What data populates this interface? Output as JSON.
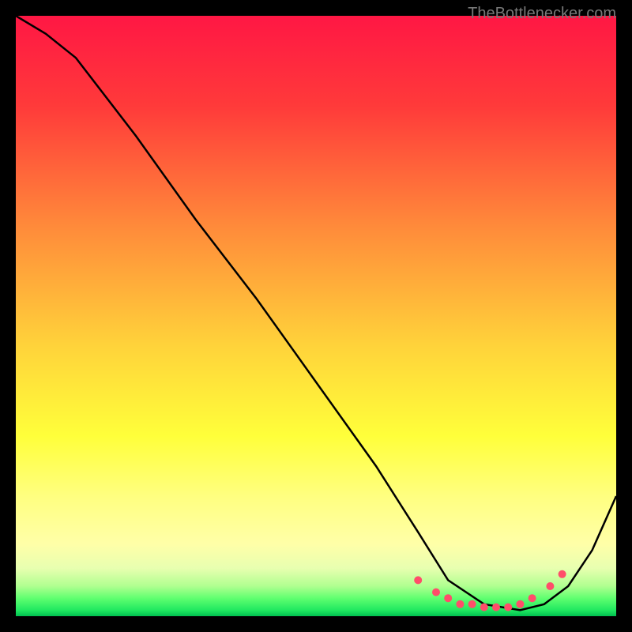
{
  "attribution": "TheBottlenecker.com",
  "chart_data": {
    "type": "line",
    "title": "",
    "xlabel": "",
    "ylabel": "",
    "xlim": [
      0,
      100
    ],
    "ylim": [
      0,
      100
    ],
    "background_gradient": {
      "stops": [
        {
          "offset": 0,
          "color": "#ff1744"
        },
        {
          "offset": 15,
          "color": "#ff3a3a"
        },
        {
          "offset": 35,
          "color": "#ff8a3a"
        },
        {
          "offset": 55,
          "color": "#ffd33a"
        },
        {
          "offset": 70,
          "color": "#ffff3a"
        },
        {
          "offset": 80,
          "color": "#ffff80"
        },
        {
          "offset": 88,
          "color": "#ffffa8"
        },
        {
          "offset": 92,
          "color": "#e8ffb0"
        },
        {
          "offset": 95,
          "color": "#b0ff90"
        },
        {
          "offset": 97,
          "color": "#60ff70"
        },
        {
          "offset": 99,
          "color": "#20e860"
        },
        {
          "offset": 100,
          "color": "#00c050"
        }
      ]
    },
    "series": [
      {
        "name": "curve",
        "x": [
          0,
          5,
          10,
          20,
          30,
          40,
          50,
          60,
          67,
          72,
          78,
          84,
          88,
          92,
          96,
          100
        ],
        "y": [
          100,
          97,
          93,
          80,
          66,
          53,
          39,
          25,
          14,
          6,
          2,
          1,
          2,
          5,
          11,
          20
        ]
      }
    ],
    "markers": {
      "name": "dots",
      "color": "#ff4d6a",
      "x": [
        67,
        70,
        72,
        74,
        76,
        78,
        80,
        82,
        84,
        86,
        89,
        91
      ],
      "y": [
        6,
        4,
        3,
        2,
        2,
        1.5,
        1.5,
        1.5,
        2,
        3,
        5,
        7
      ]
    }
  }
}
